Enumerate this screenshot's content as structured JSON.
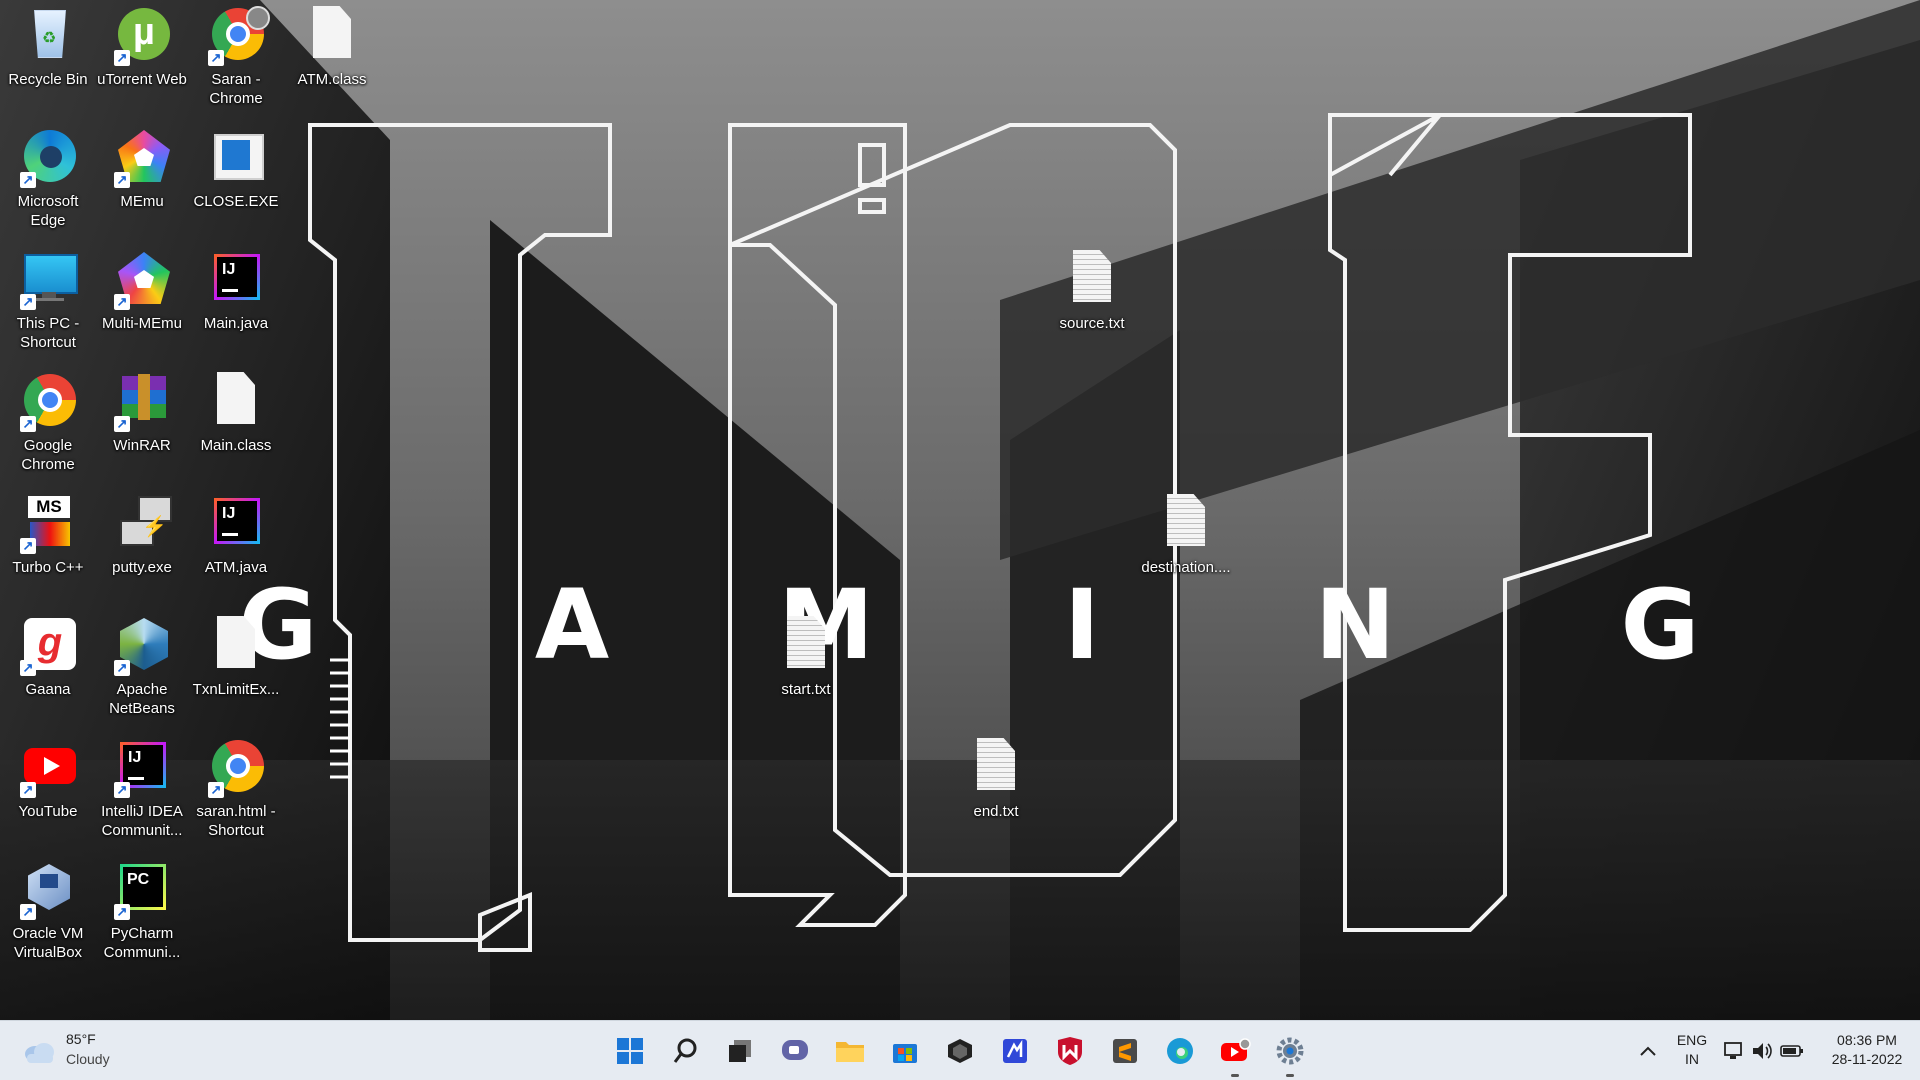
{
  "wallpaper": {
    "letters": [
      "G",
      "A",
      "M",
      "I",
      "N",
      "G"
    ]
  },
  "desktop": {
    "icons": [
      {
        "label": "Recycle Bin",
        "icon": "recycle-bin-icon"
      },
      {
        "label": "uTorrent Web",
        "icon": "utorrent-icon"
      },
      {
        "label": "Saran - Chrome",
        "icon": "chrome-icon"
      },
      {
        "label": "ATM.class",
        "icon": "file-icon"
      },
      {
        "label": "Microsoft Edge",
        "icon": "edge-icon"
      },
      {
        "label": "MEmu",
        "icon": "memu-icon"
      },
      {
        "label": "CLOSE.EXE",
        "icon": "exe-icon"
      },
      {
        "label": "This PC - Shortcut",
        "icon": "monitor-icon"
      },
      {
        "label": "Multi-MEmu",
        "icon": "multi-memu-icon"
      },
      {
        "label": "Main.java",
        "icon": "intellij-icon"
      },
      {
        "label": "Google Chrome",
        "icon": "chrome-icon"
      },
      {
        "label": "WinRAR",
        "icon": "winrar-icon"
      },
      {
        "label": "Main.class",
        "icon": "file-icon"
      },
      {
        "label": "Turbo C++",
        "icon": "turbo-cpp-icon"
      },
      {
        "label": "putty.exe",
        "icon": "putty-icon"
      },
      {
        "label": "ATM.java",
        "icon": "intellij-icon"
      },
      {
        "label": "Gaana",
        "icon": "gaana-icon"
      },
      {
        "label": "Apache NetBeans",
        "icon": "netbeans-icon"
      },
      {
        "label": "TxnLimitEx...",
        "icon": "file-icon"
      },
      {
        "label": "YouTube",
        "icon": "youtube-icon"
      },
      {
        "label": "IntelliJ IDEA Communit...",
        "icon": "intellij-icon"
      },
      {
        "label": "saran.html - Shortcut",
        "icon": "chrome-icon"
      },
      {
        "label": "Oracle VM VirtualBox",
        "icon": "virtualbox-icon"
      },
      {
        "label": "PyCharm Communi...",
        "icon": "pycharm-icon"
      },
      {
        "label": "source.txt",
        "icon": "text-file-icon"
      },
      {
        "label": "destination....",
        "icon": "text-file-icon"
      },
      {
        "label": "start.txt",
        "icon": "text-file-icon"
      },
      {
        "label": "end.txt",
        "icon": "text-file-icon"
      }
    ]
  },
  "taskbar": {
    "weather": {
      "temp": "85°F",
      "condition": "Cloudy"
    },
    "apps": [
      "start-icon",
      "search-icon",
      "task-view-icon",
      "chat-icon",
      "file-explorer-icon",
      "store-icon",
      "unity-hub-icon",
      "vs-code-icon",
      "mcafee-icon",
      "sublime-text-icon",
      "edge-icon",
      "youtube-chrome-icon",
      "settings-icon"
    ],
    "language": {
      "line1": "ENG",
      "line2": "IN"
    },
    "clock": {
      "time": "08:36 PM",
      "date": "28-11-2022"
    }
  }
}
